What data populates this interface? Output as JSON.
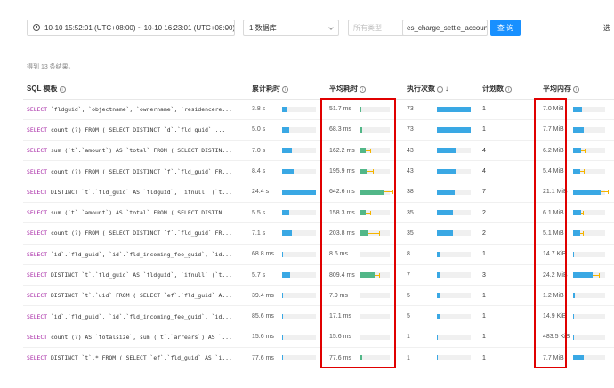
{
  "toolbar": {
    "time_range": "10-10 15:52:01 (UTC+08:00) ~ 10-10 16:23:01 (UTC+08:00)",
    "database": "1 数据库",
    "type_placeholder": "所有类型",
    "search_value": "es_charge_settle_accountr",
    "query_label": "查 询",
    "right_label": "选"
  },
  "result_count": "得到 13 条结果。",
  "columns": {
    "sql": "SQL 模板",
    "total_latency": "累计耗时",
    "avg_latency": "平均耗时",
    "exec_count": "执行次数",
    "plan_count": "计划数",
    "avg_mem": "平均内存"
  },
  "rows": [
    {
      "sql_kw": "SELECT",
      "sql_rest": " `fldguid`, `objectname`, `ownername`, `residencere...",
      "total": "3.8 s",
      "total_pct": 0.155,
      "avg": "51.7 ms",
      "avg_pct": 0.064,
      "avg_err": 0,
      "exec": "73",
      "exec_pct": 1.0,
      "plans": "1",
      "mem": "7.0 MiB",
      "mem_pct": 0.29,
      "mem_err": 0
    },
    {
      "sql_kw": "SELECT",
      "sql_rest": " count (?) FROM ( SELECT DISTINCT `d`.`fld_guid` ...",
      "total": "5.0 s",
      "total_pct": 0.2,
      "avg": "68.3 ms",
      "avg_pct": 0.085,
      "avg_err": 0,
      "exec": "73",
      "exec_pct": 1.0,
      "plans": "1",
      "mem": "7.7 MiB",
      "mem_pct": 0.32,
      "mem_err": 0
    },
    {
      "sql_kw": "SELECT",
      "sql_rest": " sum (`t`.`amount`) AS `total` FROM ( SELECT DISTIN...",
      "total": "7.0 s",
      "total_pct": 0.29,
      "avg": "162.2 ms",
      "avg_pct": 0.2,
      "avg_err": 0.3,
      "exec": "43",
      "exec_pct": 0.59,
      "plans": "4",
      "mem": "6.2 MiB",
      "mem_pct": 0.26,
      "mem_err": 0.2
    },
    {
      "sql_kw": "SELECT",
      "sql_rest": " count (?) FROM ( SELECT DISTINCT `f`.`fld_guid` FR...",
      "total": "8.4 s",
      "total_pct": 0.34,
      "avg": "195.9 ms",
      "avg_pct": 0.24,
      "avg_err": 0.4,
      "exec": "43",
      "exec_pct": 0.59,
      "plans": "4",
      "mem": "5.4 MiB",
      "mem_pct": 0.22,
      "mem_err": 0.2
    },
    {
      "sql_kw": "SELECT",
      "sql_rest": " DISTINCT `t`.`fld_guid` AS `fldguid`, `ifnull` (`t...",
      "total": "24.4 s",
      "total_pct": 1.0,
      "avg": "642.6 ms",
      "avg_pct": 0.8,
      "avg_err": 0.6,
      "exec": "38",
      "exec_pct": 0.52,
      "plans": "7",
      "mem": "21.1 MiB",
      "mem_pct": 0.87,
      "mem_err": 0.4
    },
    {
      "sql_kw": "SELECT",
      "sql_rest": " sum (`t`.`amount`) AS `total` FROM ( SELECT DISTIN...",
      "total": "5.5 s",
      "total_pct": 0.22,
      "avg": "158.3 ms",
      "avg_pct": 0.2,
      "avg_err": 0.3,
      "exec": "35",
      "exec_pct": 0.48,
      "plans": "2",
      "mem": "6.1 MiB",
      "mem_pct": 0.25,
      "mem_err": 0.1
    },
    {
      "sql_kw": "SELECT",
      "sql_rest": " count (?) FROM ( SELECT DISTINCT `f`.`fld_guid` FR...",
      "total": "7.1 s",
      "total_pct": 0.29,
      "avg": "203.8 ms",
      "avg_pct": 0.25,
      "avg_err": 0.8,
      "exec": "35",
      "exec_pct": 0.48,
      "plans": "2",
      "mem": "5.1 MiB",
      "mem_pct": 0.21,
      "mem_err": 0.2
    },
    {
      "sql_kw": "SELECT",
      "sql_rest": " `id`.`fld_guid`, `id`.`fld_incoming_fee_guid`, `id...",
      "total": "68.8 ms",
      "total_pct": 0.005,
      "avg": "8.6 ms",
      "avg_pct": 0.011,
      "avg_err": 0,
      "exec": "8",
      "exec_pct": 0.11,
      "plans": "1",
      "mem": "14.7 KiB",
      "mem_pct": 0.001,
      "mem_err": 0
    },
    {
      "sql_kw": "SELECT",
      "sql_rest": " DISTINCT `t`.`fld_guid` AS `fldguid`, `ifnull` (`t...",
      "total": "5.7 s",
      "total_pct": 0.23,
      "avg": "809.4 ms",
      "avg_pct": 0.5,
      "avg_err": 0.3,
      "exec": "7",
      "exec_pct": 0.1,
      "plans": "3",
      "mem": "24.2 MiB",
      "mem_pct": 0.6,
      "mem_err": 0.4
    },
    {
      "sql_kw": "SELECT",
      "sql_rest": " DISTINCT `t`.`uid` FROM ( SELECT `ef`.`fld_guid` A...",
      "total": "39.4 ms",
      "total_pct": 0.003,
      "avg": "7.9 ms",
      "avg_pct": 0.01,
      "avg_err": 0,
      "exec": "5",
      "exec_pct": 0.07,
      "plans": "1",
      "mem": "1.2 MiB",
      "mem_pct": 0.05,
      "mem_err": 0
    },
    {
      "sql_kw": "SELECT",
      "sql_rest": " `id`.`fld_guid`, `id`.`fld_incoming_fee_guid`, `id...",
      "total": "85.6 ms",
      "total_pct": 0.006,
      "avg": "17.1 ms",
      "avg_pct": 0.021,
      "avg_err": 0,
      "exec": "5",
      "exec_pct": 0.07,
      "plans": "1",
      "mem": "14.9 KiB",
      "mem_pct": 0.001,
      "mem_err": 0
    },
    {
      "sql_kw": "SELECT",
      "sql_rest": " count (?) AS `totalsize`, sum (`t`.`arrears`) AS `...",
      "total": "15.6 ms",
      "total_pct": 0.001,
      "avg": "15.6 ms",
      "avg_pct": 0.019,
      "avg_err": 0,
      "exec": "1",
      "exec_pct": 0.014,
      "plans": "1",
      "mem": "483.5 KiB",
      "mem_pct": 0.02,
      "mem_err": 0
    },
    {
      "sql_kw": "SELECT",
      "sql_rest": " DISTINCT `t`.* FROM ( SELECT `ef`.`fld_guid` AS `i...",
      "total": "77.6 ms",
      "total_pct": 0.006,
      "avg": "77.6 ms",
      "avg_pct": 0.096,
      "avg_err": 0,
      "exec": "1",
      "exec_pct": 0.014,
      "plans": "1",
      "mem": "7.7 MiB",
      "mem_pct": 0.32,
      "mem_err": 0
    }
  ]
}
